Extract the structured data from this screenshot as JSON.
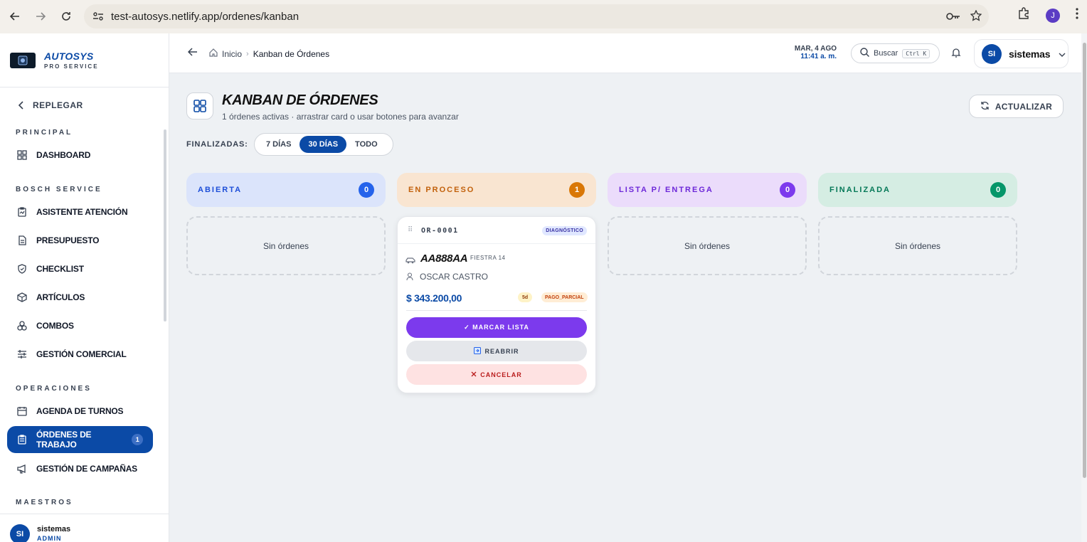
{
  "browser": {
    "url": "test-autosys.netlify.app/ordenes/kanban",
    "profile_initial": "J"
  },
  "brand": {
    "name": "AUTOSYS",
    "tagline": "PRO SERVICE"
  },
  "sidebar": {
    "collapse_label": "REPLEGAR",
    "sections": {
      "principal": "PRINCIPAL",
      "bosch": "BOSCH SERVICE",
      "operaciones": "OPERACIONES",
      "maestros": "MAESTROS"
    },
    "items": [
      {
        "label": "DASHBOARD",
        "icon": "grid-icon"
      },
      {
        "label": "ASISTENTE ATENCIÓN",
        "icon": "clipboard-icon"
      },
      {
        "label": "PRESUPUESTO",
        "icon": "document-icon"
      },
      {
        "label": "CHECKLIST",
        "icon": "shield-check-icon"
      },
      {
        "label": "ARTÍCULOS",
        "icon": "box-icon"
      },
      {
        "label": "COMBOS",
        "icon": "combo-icon"
      },
      {
        "label": "GESTIÓN COMERCIAL",
        "icon": "sliders-icon"
      },
      {
        "label": "AGENDA DE TURNOS",
        "icon": "calendar-icon"
      },
      {
        "label": "ÓRDENES DE TRABAJO",
        "icon": "clipboard-list-icon",
        "badge": "1",
        "active": true
      },
      {
        "label": "GESTIÓN DE CAMPAÑAS",
        "icon": "megaphone-icon"
      }
    ],
    "footer": {
      "initials": "SI",
      "user": "sistemas",
      "role": "ADMIN"
    }
  },
  "header": {
    "breadcrumb_home": "Inicio",
    "breadcrumb_current": "Kanban de Órdenes",
    "date": "MAR, 4 AGO",
    "time": "11:41 a. m.",
    "search_label": "Buscar",
    "search_shortcut": "Ctrl K",
    "user_initials": "SI",
    "user_name": "sistemas"
  },
  "main": {
    "title": "KANBAN DE ÓRDENES",
    "subtitle": "1 órdenes activas · arrastrar card o usar botones para avanzar",
    "refresh_label": "ACTUALIZAR",
    "filter_label": "FINALIZADAS:",
    "filter_options": [
      "7 DÍAS",
      "30 DÍAS",
      "TODO"
    ],
    "filter_selected": "30 DÍAS",
    "empty_label": "Sin órdenes",
    "columns": [
      {
        "title": "ABIERTA",
        "count": "0",
        "bg": "#dbe4fb",
        "fg": "#1d4ed8",
        "badge": "#2563eb"
      },
      {
        "title": "EN PROCESO",
        "count": "1",
        "bg": "#f9e5d1",
        "fg": "#c2610c",
        "badge": "#d97706"
      },
      {
        "title": "LISTA P/ ENTREGA",
        "count": "0",
        "bg": "#ebdcfb",
        "fg": "#6d28d9",
        "badge": "#7c3aed"
      },
      {
        "title": "FINALIZADA",
        "count": "0",
        "bg": "#d5ede3",
        "fg": "#047857",
        "badge": "#059669"
      }
    ],
    "card": {
      "order_id": "OR-0001",
      "stage": "DIAGNÓSTICO",
      "plate": "AA888AA",
      "model": "FIESTRA 14",
      "client": "OSCAR CASTRO",
      "amount": "$ 343.200,00",
      "days": "5d",
      "payment": "PAGO_PARCIAL",
      "btn_ready": "✓ MARCAR LISTA",
      "btn_reopen": "REABRIR",
      "btn_cancel": "CANCELAR"
    }
  }
}
